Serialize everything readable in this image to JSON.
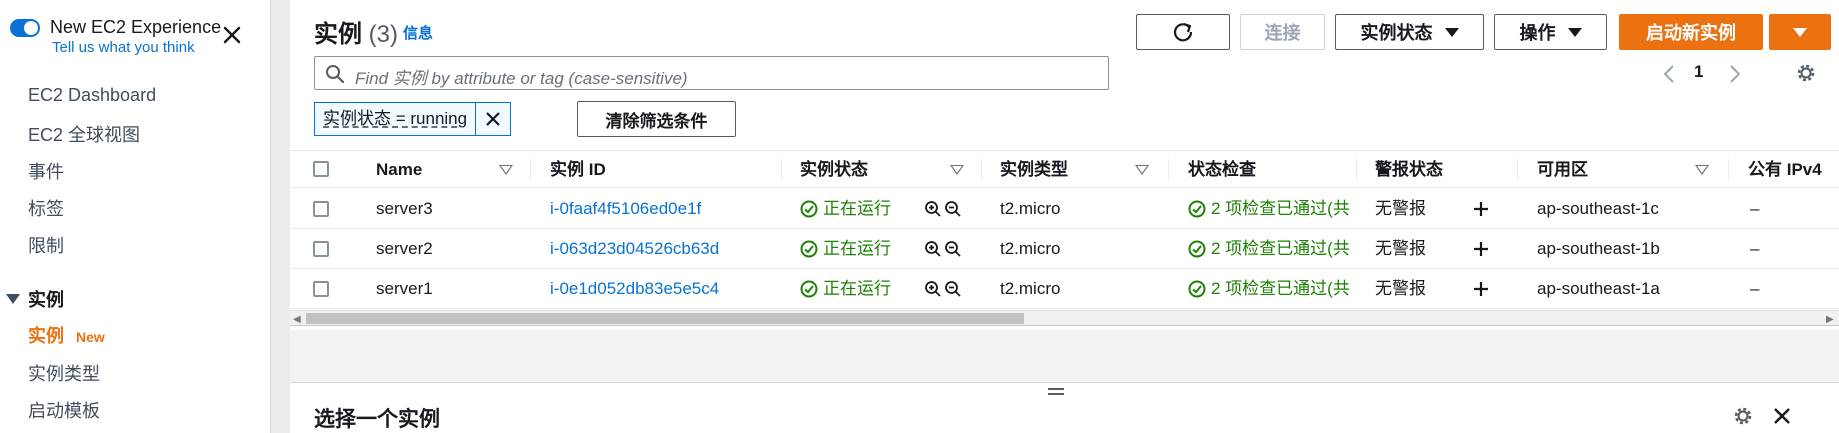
{
  "sidebar": {
    "experience_title": "New EC2 Experience",
    "experience_link": "Tell us what you think",
    "items": [
      "EC2 Dashboard",
      "EC2 全球视图",
      "事件",
      "标签",
      "限制"
    ],
    "section_title": "实例",
    "section_items": [
      {
        "label": "实例",
        "badge": "New"
      },
      {
        "label": "实例类型",
        "badge": ""
      },
      {
        "label": "启动模板",
        "badge": ""
      }
    ]
  },
  "header": {
    "title": "实例",
    "count": "(3)",
    "info": "信息",
    "connect_label": "连接",
    "instance_state_label": "实例状态",
    "actions_label": "操作",
    "launch_label": "启动新实例"
  },
  "search": {
    "placeholder": "Find 实例 by attribute or tag (case-sensitive)"
  },
  "pagination": {
    "page": "1"
  },
  "filter": {
    "token": "实例状态 = running",
    "clear_label": "清除筛选条件"
  },
  "table": {
    "columns": [
      "Name",
      "实例 ID",
      "实例状态",
      "实例类型",
      "状态检查",
      "警报状态",
      "可用区",
      "公有 IPv4"
    ],
    "rows": [
      {
        "name": "server3",
        "id": "i-0faaf4f5106ed0e1f",
        "state": "正在运行",
        "type": "t2.micro",
        "check": "2 项检查已通过(共",
        "alarm": "无警报",
        "az": "ap-southeast-1c",
        "ipv4": "–"
      },
      {
        "name": "server2",
        "id": "i-063d23d04526cb63d",
        "state": "正在运行",
        "type": "t2.micro",
        "check": "2 项检查已通过(共",
        "alarm": "无警报",
        "az": "ap-southeast-1b",
        "ipv4": "–"
      },
      {
        "name": "server1",
        "id": "i-0e1d052db83e5e5c4",
        "state": "正在运行",
        "type": "t2.micro",
        "check": "2 项检查已通过(共",
        "alarm": "无警报",
        "az": "ap-southeast-1a",
        "ipv4": "–"
      }
    ]
  },
  "split_panel": {
    "title": "选择一个实例"
  },
  "colors": {
    "accent": "#ec7211",
    "link": "#0972d3",
    "success": "#1d8102"
  },
  "icons": [
    "refresh-icon",
    "search-icon",
    "settings-icon",
    "close-icon",
    "zoom-in-icon",
    "zoom-out-icon",
    "plus-icon",
    "status-ok-icon"
  ]
}
